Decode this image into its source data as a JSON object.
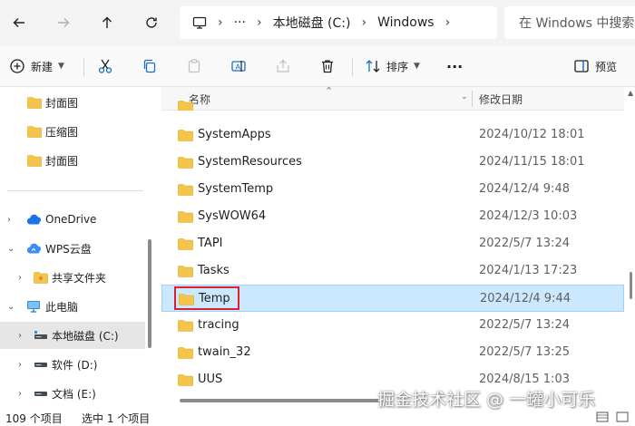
{
  "address_bar": {
    "breadcrumbs": [
      "本地磁盘 (C:)",
      "Windows"
    ],
    "more_glyph": "···",
    "separator": "›",
    "search_placeholder": "在 Windows 中搜索"
  },
  "toolbar": {
    "new_label": "新建",
    "sort_label": "排序",
    "preview_label": "预览",
    "more_glyph": "···"
  },
  "sidebar": {
    "items": [
      {
        "label": "封面图",
        "icon": "folder-icon"
      },
      {
        "label": "压缩图",
        "icon": "folder-icon"
      },
      {
        "label": "封面图",
        "icon": "folder-icon"
      },
      {
        "label": "OneDrive",
        "icon": "onedrive-cloud-icon"
      },
      {
        "label": "WPS云盘",
        "icon": "wps-cloud-icon"
      },
      {
        "label": "共享文件夹",
        "icon": "shared-folder-icon"
      },
      {
        "label": "此电脑",
        "icon": "computer-icon"
      },
      {
        "label": "本地磁盘 (C:)",
        "icon": "drive-icon",
        "selected": true
      },
      {
        "label": "软件 (D:)",
        "icon": "drive-icon"
      },
      {
        "label": "文档 (E:)",
        "icon": "drive-icon"
      }
    ]
  },
  "file_list": {
    "columns": {
      "name": "名称",
      "date": "修改日期"
    },
    "rows": [
      {
        "name": "SystemApps",
        "date": "2024/10/12 18:01"
      },
      {
        "name": "SystemResources",
        "date": "2024/11/15 18:01"
      },
      {
        "name": "SystemTemp",
        "date": "2024/12/4 9:48"
      },
      {
        "name": "SysWOW64",
        "date": "2024/12/3 10:03"
      },
      {
        "name": "TAPI",
        "date": "2022/5/7 13:24"
      },
      {
        "name": "Tasks",
        "date": "2024/1/13 17:23"
      },
      {
        "name": "Temp",
        "date": "2024/12/4 9:44",
        "selected": true
      },
      {
        "name": "tracing",
        "date": "2022/5/7 13:24"
      },
      {
        "name": "twain_32",
        "date": "2022/5/7 13:25"
      },
      {
        "name": "UUS",
        "date": "2024/8/15 1:03"
      }
    ]
  },
  "status": {
    "item_count": "109 个项目",
    "selected_count": "选中 1 个项目"
  },
  "watermark": "掘金技术社区 @ 一罐小可乐",
  "colors": {
    "selection": "#cce8ff",
    "highlight": "#d8232a",
    "folder": "#f4c54a"
  }
}
